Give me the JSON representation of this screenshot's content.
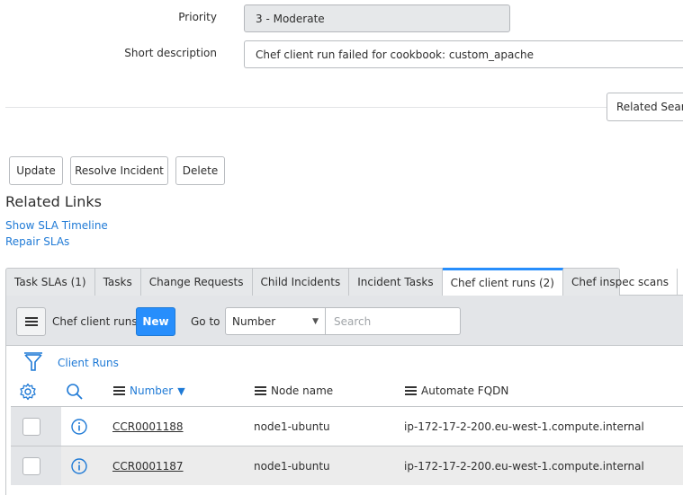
{
  "form": {
    "priority": {
      "label": "Priority",
      "value": "3 - Moderate"
    },
    "short_description": {
      "label": "Short description",
      "value": "Chef client run failed for cookbook: custom_apache"
    },
    "related_search_label": "Related Searc"
  },
  "actions": {
    "update": "Update",
    "resolve": "Resolve Incident",
    "delete": "Delete"
  },
  "related_links": {
    "title": "Related Links",
    "items": [
      "Show SLA Timeline",
      "Repair SLAs"
    ]
  },
  "tabs": [
    {
      "label": "Task SLAs (1)",
      "active": false
    },
    {
      "label": "Tasks",
      "active": false
    },
    {
      "label": "Change Requests",
      "active": false
    },
    {
      "label": "Child Incidents",
      "active": false
    },
    {
      "label": "Incident Tasks",
      "active": false
    },
    {
      "label": "Chef client runs (2)",
      "active": true
    },
    {
      "label": "Chef inspec scans",
      "active": false
    }
  ],
  "list": {
    "title": "Chef client runs",
    "new_label": "New",
    "goto_label": "Go to",
    "goto_field": "Number",
    "search_placeholder": "Search",
    "breadcrumb": "Client Runs",
    "columns": [
      {
        "label": "Number",
        "sorted": "desc"
      },
      {
        "label": "Node name"
      },
      {
        "label": "Automate FQDN"
      }
    ],
    "rows": [
      {
        "number": "CCR0001188",
        "node": "node1-ubuntu",
        "fqdn": "ip-172-17-2-200.eu-west-1.compute.internal"
      },
      {
        "number": "CCR0001187",
        "node": "node1-ubuntu",
        "fqdn": "ip-172-17-2-200.eu-west-1.compute.internal"
      }
    ]
  },
  "colors": {
    "accent": "#278efc",
    "link": "#1f7ad6"
  }
}
